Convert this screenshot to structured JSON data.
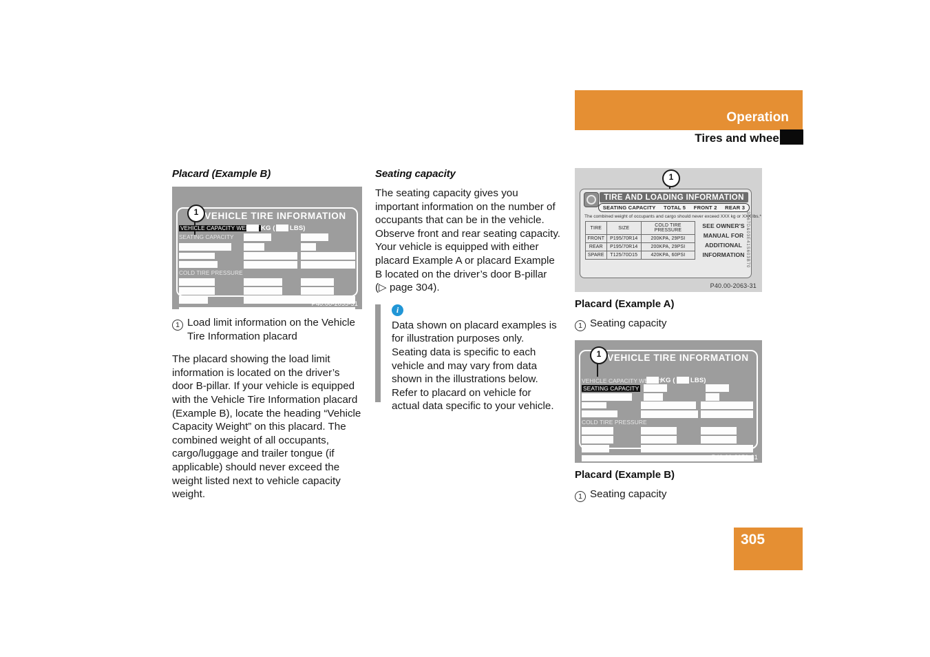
{
  "header": {
    "title": "Operation",
    "subtitle": "Tires and wheels"
  },
  "page_number": "305",
  "left_column": {
    "heading": "Placard (Example B)",
    "figure": {
      "title": "VEHICLE TIRE INFORMATION",
      "label_capacity_weight": "VEHICLE CAPACITY WEIGHT",
      "label_kg": "KG (",
      "label_lbs": "LBS)",
      "label_seating_capacity": "SEATING CAPACITY",
      "label_cold_tire_pressure": "COLD TIRE PRESSURE",
      "callout": "1",
      "code": "P40.00-2055-31"
    },
    "caption": {
      "number": "1",
      "text": "Load limit information on the Vehicle Tire Information placard"
    },
    "body": "The placard showing the load limit information is located on the driver’s door B-pillar. If your vehicle is equipped with the Vehicle Tire Information placard (Example B), locate the heading “Vehicle Capacity Weight” on this placard. The combined weight of all occupants, cargo/luggage and trailer tongue (if applicable) should never exceed the weight listed next to vehicle capacity weight."
  },
  "middle_column": {
    "heading": "Seating capacity",
    "body": "The seating capacity gives you important information on the number of occupants that can be in the vehicle. Observe front and rear seating capacity. Your vehicle is equipped with either placard Example A or placard Example B located on the driver’s door B-pillar (▷ page 304).",
    "info": {
      "icon": "info-icon",
      "text": "Data shown on placard examples is for illustration purposes only. Seating data is specific to each vehicle and may vary from data shown in the illustrations below. Refer to placard on vehicle for actual data specific to your vehicle."
    }
  },
  "right_column": {
    "placard_a": {
      "figure": {
        "title": "TIRE AND LOADING INFORMATION",
        "seating_capacity_label": "SEATING CAPACITY",
        "seating_total": "TOTAL  5",
        "seating_front": "FRONT  2",
        "seating_rear": "REAR  3",
        "note": "The combined weight of occupants and cargo should never exceed XXX kg or XXX lbs.*",
        "table": {
          "headers": [
            "TIRE",
            "SIZE",
            "COLD TIRE PRESSURE"
          ],
          "rows": [
            [
              "FRONT",
              "P195/70R14",
              "200KPA, 29PSI"
            ],
            [
              "REAR",
              "P195/70R14",
              "200KPA, 29PSI"
            ],
            [
              "SPARE",
              "T125/70D15",
              "420KPA, 60PSI"
            ]
          ]
        },
        "owners_manual": "SEE OWNER'S MANUAL FOR ADDITIONAL INFORMATION",
        "side_code": "3B67D&03E41S603B70",
        "callout": "1",
        "code": "P40.00-2063-31"
      },
      "caption_heading": "Placard (Example A)",
      "caption": {
        "number": "1",
        "text": "Seating capacity"
      }
    },
    "placard_b": {
      "figure": {
        "title": "VEHICLE TIRE INFORMATION",
        "label_capacity_weight": "VEHICLE CAPACITY WEIGHT",
        "label_kg": "KG (",
        "label_lbs": "LBS)",
        "label_seating_capacity": "SEATING CAPACITY",
        "label_cold_tire_pressure": "COLD TIRE PRESSURE",
        "callout": "1",
        "code": "P40.00-2056-31"
      },
      "caption_heading": "Placard (Example B)",
      "caption": {
        "number": "1",
        "text": "Seating capacity"
      }
    }
  },
  "colors": {
    "accent_orange": "#e58f33",
    "info_blue": "#2196d6",
    "placard_gray": "#9d9d9d"
  }
}
